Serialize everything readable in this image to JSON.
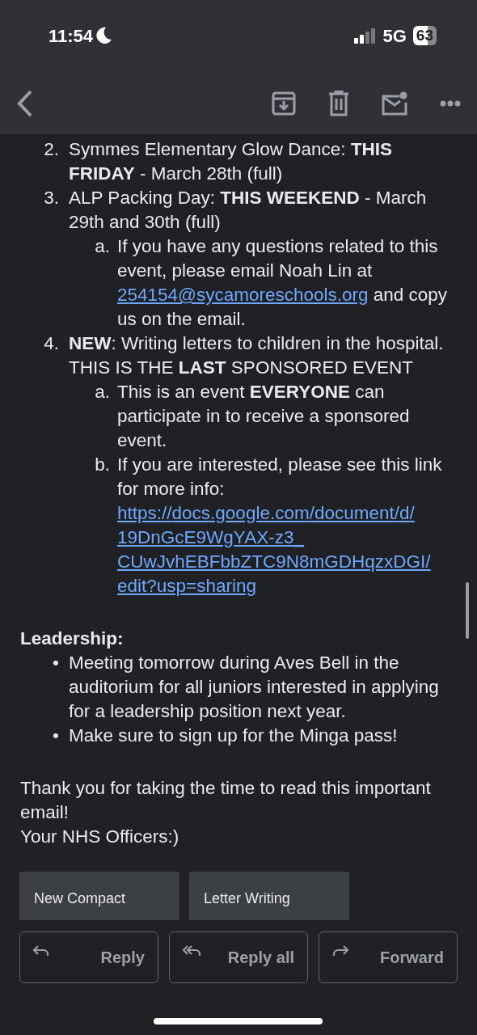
{
  "status_bar": {
    "time": "11:54",
    "network": "5G",
    "battery": "63"
  },
  "body": [
    {
      "kind": "list",
      "items": [
        {
          "marker": "2.",
          "text": "Symmes Elementary Glow Dance: **THIS FRIDAY** - March 28th (full)"
        },
        {
          "marker": "3.",
          "text": "ALP Packing Day: **THIS WEEKEND** - March 29th and 30th (full)",
          "children": [
            {
              "marker": "a.",
              "text": "If you have any questions related to this event, please email Noah Lin at ",
              "link": "254154@sycamoreschools.org",
              "after": " and copy us on the email."
            }
          ]
        },
        {
          "marker": "4.",
          "text": "**NEW**: Writing letters to children in the hospital. THIS IS THE **LAST** SPONSORED EVENT",
          "children": [
            {
              "marker": "a.",
              "text": "This is an event **EVERYONE** can participate in to receive a sponsored event."
            },
            {
              "marker": "b.",
              "text": "If you are interested, please see this link for more info: ",
              "link": "https://docs.google.com/document/d/19DnGcE9WgYAX-z3_CUwJvhEBFbbZTC9N8mGDHqzxDGI/edit?usp=sharing"
            }
          ]
        }
      ]
    },
    {
      "kind": "heading",
      "text": "Leadership:"
    },
    {
      "kind": "list",
      "items": [
        {
          "marker": "•",
          "text": "Meeting tomorrow during Aves Bell in the auditorium for all juniors interested in applying for a leadership position next year."
        },
        {
          "marker": "•",
          "text": "Make sure to sign up for the Minga pass!"
        }
      ]
    },
    {
      "kind": "paragraph",
      "text": "Thank you for taking the time to read this important email!"
    },
    {
      "kind": "paragraph",
      "text": "Your NHS Officers:)"
    }
  ],
  "related": [
    {
      "title": "New Compact"
    },
    {
      "title": "Letter Writing"
    }
  ],
  "actions": [
    {
      "kind": "reply",
      "label": "Reply"
    },
    {
      "kind": "reply_all",
      "label": "Reply all"
    },
    {
      "kind": "forward",
      "label": "Forward"
    }
  ]
}
